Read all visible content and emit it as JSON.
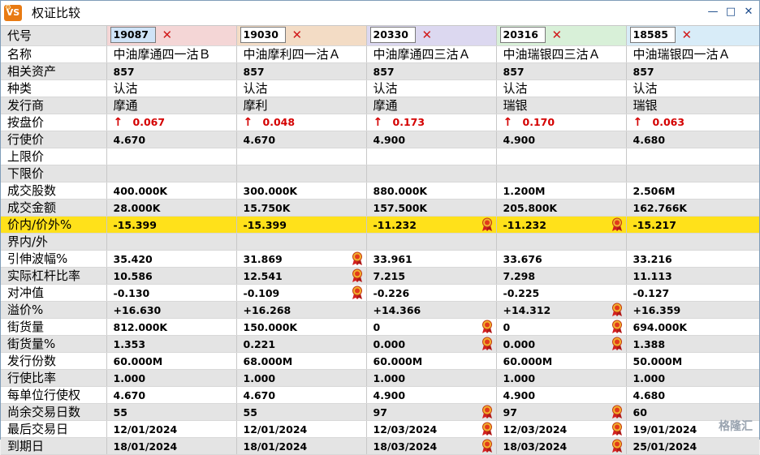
{
  "window": {
    "title": "权证比较",
    "icon_text": "VS",
    "controls": [
      "—",
      "□",
      "✕"
    ]
  },
  "columns": [
    {
      "code": "19087",
      "selected": true
    },
    {
      "code": "19030",
      "selected": false
    },
    {
      "code": "20330",
      "selected": false
    },
    {
      "code": "20316",
      "selected": false
    },
    {
      "code": "18585",
      "selected": false
    }
  ],
  "header_colors": [
    "#f4d6d6",
    "#f3dcc5",
    "#dcd8f0",
    "#d8f0d8",
    "#d8ecf8"
  ],
  "rows": [
    {
      "label": "名称",
      "kind": "txt",
      "values": [
        "中油摩通四一沽Ｂ",
        "中油摩利四一沽Ａ",
        "中油摩通四三沽Ａ",
        "中油瑞银四三沽Ａ",
        "中油瑞银四一沽Ａ"
      ]
    },
    {
      "label": "相关资产",
      "values": [
        "857",
        "857",
        "857",
        "857",
        "857"
      ]
    },
    {
      "label": "种类",
      "kind": "txt",
      "values": [
        "认沽",
        "认沽",
        "认沽",
        "认沽",
        "认沽"
      ]
    },
    {
      "label": "发行商",
      "kind": "txt",
      "values": [
        "摩通",
        "摩利",
        "摩通",
        "瑞银",
        "瑞银"
      ]
    },
    {
      "label": "按盘价",
      "kind": "price",
      "values": [
        "0.067",
        "0.048",
        "0.173",
        "0.170",
        "0.063"
      ]
    },
    {
      "label": "行使价",
      "values": [
        "4.670",
        "4.670",
        "4.900",
        "4.900",
        "4.680"
      ]
    },
    {
      "label": "上限价",
      "values": [
        "",
        "",
        "",
        "",
        ""
      ]
    },
    {
      "label": "下限价",
      "values": [
        "",
        "",
        "",
        "",
        ""
      ]
    },
    {
      "label": "成交股数",
      "values": [
        "400.000K",
        "300.000K",
        "880.000K",
        "1.200M",
        "2.506M"
      ]
    },
    {
      "label": "成交金额",
      "values": [
        "28.000K",
        "15.750K",
        "157.500K",
        "205.800K",
        "162.766K"
      ]
    },
    {
      "label": "价内/价外%",
      "highlight": true,
      "values": [
        "-15.399",
        "-15.399",
        "-11.232",
        "-11.232",
        "-15.217"
      ],
      "ribbons": [
        2,
        3
      ]
    },
    {
      "label": "界内/外",
      "values": [
        "",
        "",
        "",
        "",
        ""
      ]
    },
    {
      "label": "引伸波幅%",
      "values": [
        "35.420",
        "31.869",
        "33.961",
        "33.676",
        "33.216"
      ],
      "ribbons": [
        1
      ]
    },
    {
      "label": "实际杠杆比率",
      "values": [
        "10.586",
        "12.541",
        "7.215",
        "7.298",
        "11.113"
      ],
      "ribbons": [
        1
      ]
    },
    {
      "label": "对冲值",
      "values": [
        "-0.130",
        "-0.109",
        "-0.226",
        "-0.225",
        "-0.127"
      ],
      "ribbons": [
        1
      ]
    },
    {
      "label": "溢价%",
      "values": [
        "+16.630",
        "+16.268",
        "+14.366",
        "+14.312",
        "+16.359"
      ],
      "ribbons": [
        3
      ]
    },
    {
      "label": "街货量",
      "values": [
        "812.000K",
        "150.000K",
        "0",
        "0",
        "694.000K"
      ],
      "ribbons": [
        2,
        3
      ]
    },
    {
      "label": "街货量%",
      "values": [
        "1.353",
        "0.221",
        "0.000",
        "0.000",
        "1.388"
      ],
      "ribbons": [
        2,
        3
      ]
    },
    {
      "label": "发行份数",
      "values": [
        "60.000M",
        "68.000M",
        "60.000M",
        "60.000M",
        "50.000M"
      ]
    },
    {
      "label": "行使比率",
      "values": [
        "1.000",
        "1.000",
        "1.000",
        "1.000",
        "1.000"
      ]
    },
    {
      "label": "每单位行使权",
      "values": [
        "4.670",
        "4.670",
        "4.900",
        "4.900",
        "4.680"
      ]
    },
    {
      "label": "尚余交易日数",
      "values": [
        "55",
        "55",
        "97",
        "97",
        "60"
      ],
      "ribbons": [
        2,
        3
      ]
    },
    {
      "label": "最后交易日",
      "values": [
        "12/01/2024",
        "12/01/2024",
        "12/03/2024",
        "12/03/2024",
        "19/01/2024"
      ],
      "ribbons": [
        2,
        3
      ]
    },
    {
      "label": "到期日",
      "values": [
        "18/01/2024",
        "18/01/2024",
        "18/03/2024",
        "18/03/2024",
        "25/01/2024"
      ],
      "ribbons": [
        2,
        3
      ]
    }
  ],
  "header_label": "代号",
  "watermark": "格隆汇"
}
